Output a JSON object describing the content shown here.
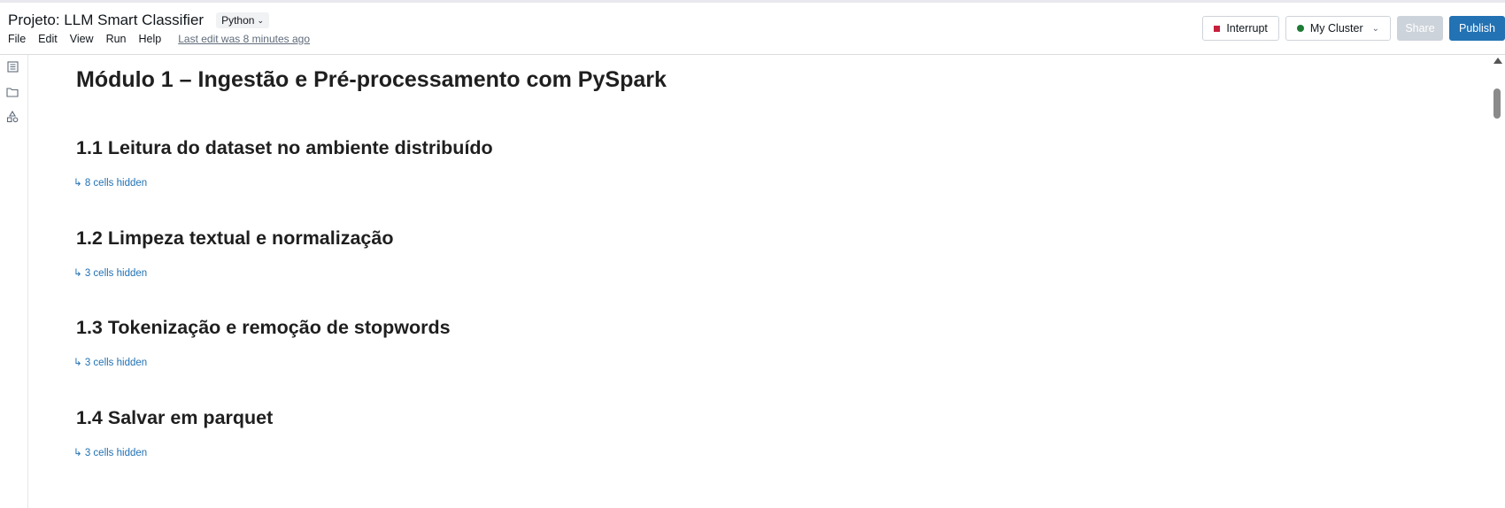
{
  "notebook": {
    "title": "Projeto: LLM Smart Classifier",
    "language": "Python",
    "last_edit": "Last edit was 8 minutes ago"
  },
  "menu": {
    "items": [
      "File",
      "Edit",
      "View",
      "Run",
      "Help"
    ]
  },
  "toolbar": {
    "interrupt_label": "Interrupt",
    "cluster_label": "My Cluster",
    "share_label": "Share",
    "publish_label": "Publish"
  },
  "sidebar": {
    "icons": [
      "table-of-contents-icon",
      "folder-icon",
      "shapes-icon"
    ]
  },
  "content": {
    "heading": "Módulo 1 – Ingestão e Pré-processamento com PySpark",
    "sections": [
      {
        "title": "1.1 Leitura do dataset no ambiente distribuído",
        "hidden": "↳ 8 cells hidden"
      },
      {
        "title": "1.2 Limpeza textual e normalização",
        "hidden": "↳ 3 cells hidden"
      },
      {
        "title": "1.3 Tokenização e remoção de stopwords",
        "hidden": "↳ 3 cells hidden"
      },
      {
        "title": "1.4 Salvar em parquet",
        "hidden": "↳ 3 cells hidden"
      }
    ]
  },
  "colors": {
    "accent": "#2272b4",
    "interrupt": "#c8203c",
    "cluster_status": "#1e7b34"
  }
}
